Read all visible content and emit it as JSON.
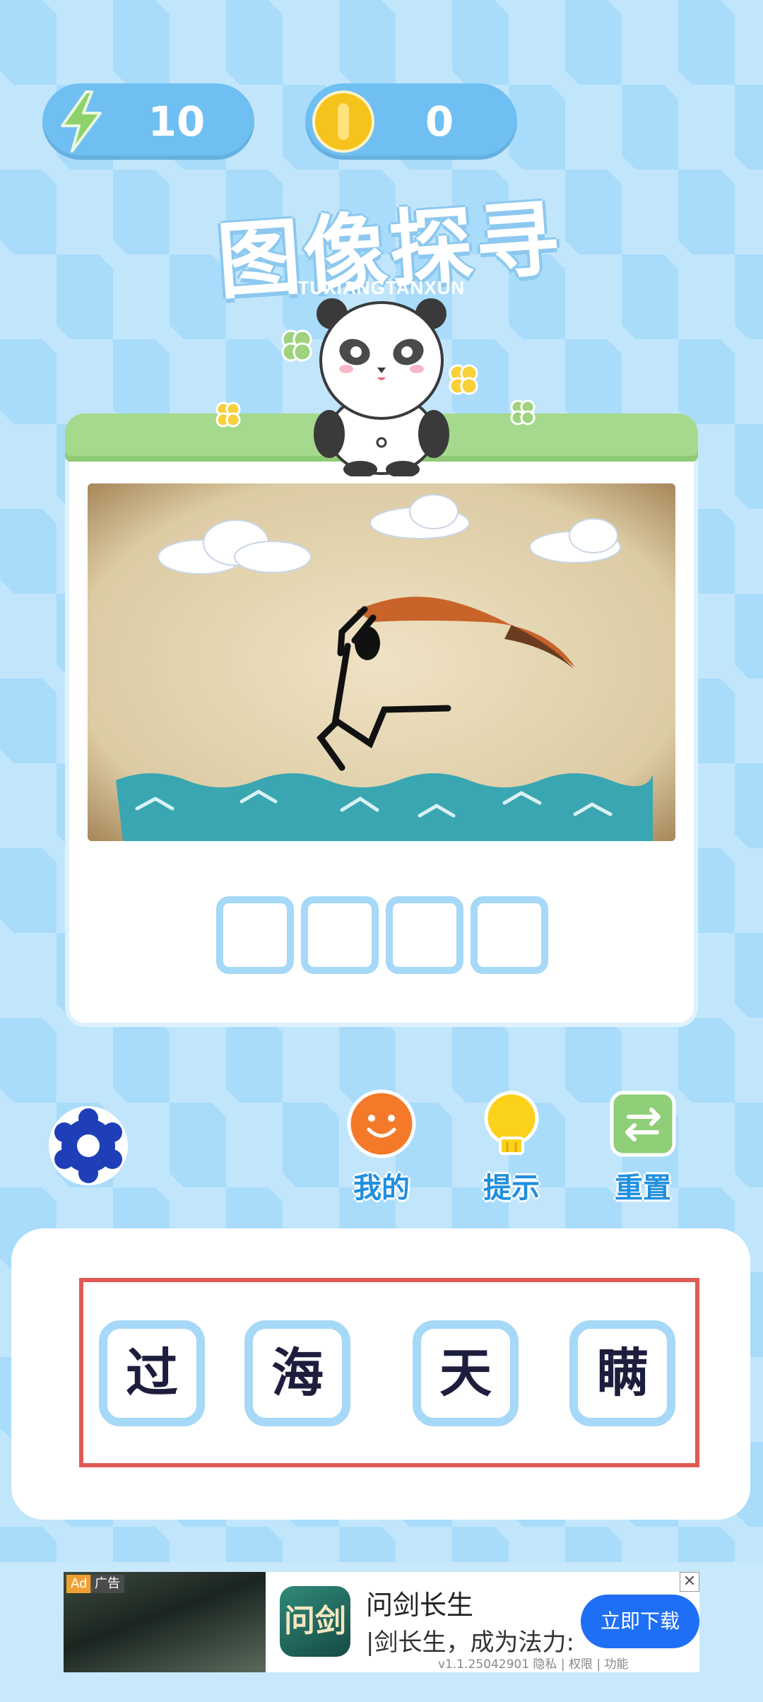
{
  "stats": {
    "energy": {
      "value": "10",
      "icon": "lightning-icon"
    },
    "coins": {
      "value": "0",
      "icon": "coin-icon"
    }
  },
  "header": {
    "title": "图像探寻",
    "subtitle": "TUXIANGTANXUN",
    "mascot": "panda"
  },
  "puzzle": {
    "answer_slots": 4
  },
  "actions": {
    "settings": {
      "icon": "gear-icon"
    },
    "mine": {
      "label": "我的",
      "icon": "smiley-icon"
    },
    "hint": {
      "label": "提示",
      "icon": "lightbulb-icon"
    },
    "reset": {
      "label": "重置",
      "icon": "swap-icon"
    }
  },
  "choices": [
    "过",
    "海",
    "天",
    "瞒"
  ],
  "ad": {
    "tag_ad": "Ad",
    "tag_label": "广告",
    "app_icon_text": "问剑",
    "title": "问剑长生",
    "description": "|剑长生，成为法力:",
    "meta": "v1.1.25042901 隐私 | 权限 | 功能",
    "cta": "立即下载",
    "close": "✕"
  },
  "colors": {
    "background": "#a9dcfb",
    "pill": "#6fbff2",
    "card_header": "#a5d98d",
    "slot_border": "#a6d8f7",
    "label_blue": "#1f8fe0",
    "highlight_frame": "#e05a55",
    "cta_blue": "#1e6ff5"
  }
}
